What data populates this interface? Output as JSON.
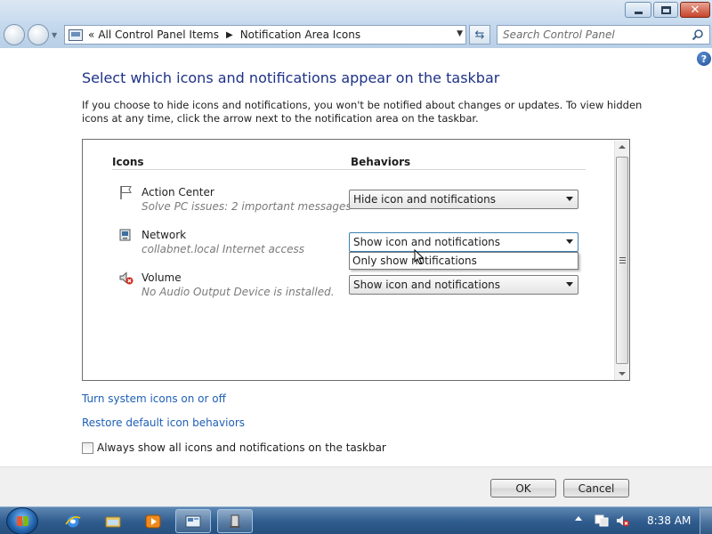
{
  "window": {
    "caption_buttons": [
      "minimize",
      "maximize",
      "close"
    ]
  },
  "navbar": {
    "breadcrumb_overflow": "«",
    "breadcrumbs": [
      "All Control Panel Items",
      "Notification Area Icons"
    ],
    "search_placeholder": "Search Control Panel"
  },
  "page": {
    "help_glyph": "?",
    "title": "Select which icons and notifications appear on the taskbar",
    "intro": "If you choose to hide icons and notifications, you won't be notified about changes or updates. To view hidden icons at any time, click the arrow next to the notification area on the taskbar.",
    "columns": {
      "icons": "Icons",
      "behaviors": "Behaviors"
    },
    "rows": [
      {
        "name": "Action Center",
        "desc": "Solve PC issues: 2 important messages",
        "behavior": "Hide icon and notifications",
        "icon": "flag-icon"
      },
      {
        "name": "Network",
        "desc": "collabnet.local Internet access",
        "behavior": "Show icon and notifications",
        "icon": "network-icon"
      },
      {
        "name": "Volume",
        "desc": "No Audio Output Device is installed.",
        "behavior": "Show icon and notifications",
        "icon": "speaker-muted-icon"
      }
    ],
    "dropdown_open_option": "Only show notifications",
    "links": {
      "system_icons": "Turn system icons on or off",
      "restore": "Restore default icon behaviors"
    },
    "always_show_label": "Always show all icons and notifications on the taskbar",
    "always_show_checked": false,
    "ok_label": "OK",
    "cancel_label": "Cancel"
  },
  "taskbar": {
    "items": [
      "internet-explorer-icon",
      "windows-explorer-icon",
      "media-player-icon",
      "control-panel-icon",
      "server-manager-icon"
    ],
    "clock": "8:38 AM"
  },
  "colors": {
    "title_blue": "#1e3287",
    "link_blue": "#1d5fb5",
    "taskbar": "#2f5c8e"
  }
}
